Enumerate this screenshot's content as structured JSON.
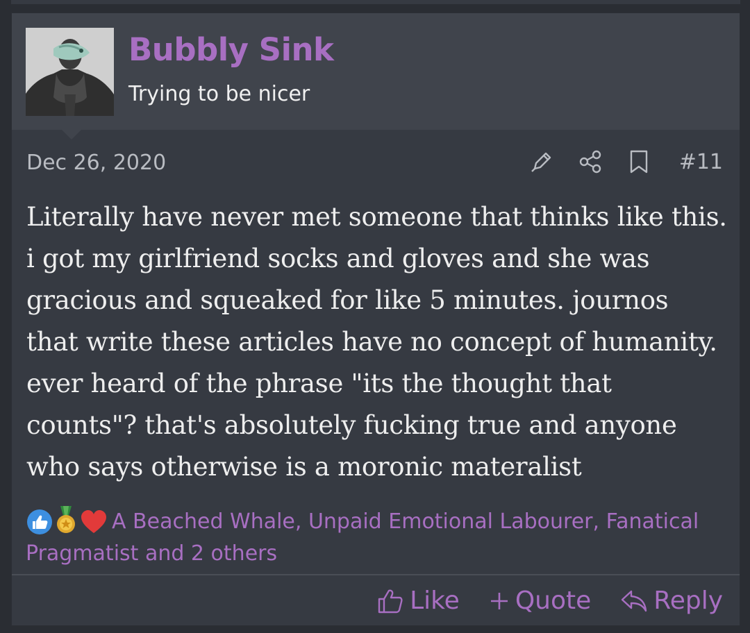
{
  "user": {
    "name": "Bubbly Sink",
    "title": "Trying to be nicer"
  },
  "post": {
    "date": "Dec 26, 2020",
    "number": "#11",
    "body": "Literally have never met someone that thinks like this. i got my girlfriend socks and gloves and she was gracious and squeaked for like 5 minutes. journos that write these articles have no concept of humanity. ever heard of the phrase \"its the thought that counts\"? that's absolutely fucking true and anyone who says otherwise is a moronic materalist"
  },
  "reactions": {
    "icons": [
      "like-icon",
      "medal-icon",
      "heart-icon"
    ],
    "text": "A Beached Whale, Unpaid Emotional Labourer, Fanatical Pragmatist and 2 others"
  },
  "tools": {
    "icons": [
      "edit-pen-icon",
      "share-icon",
      "bookmark-icon"
    ]
  },
  "actions": {
    "like_label": "Like",
    "quote_label": "Quote",
    "reply_label": "Reply"
  },
  "colors": {
    "accent": "#a86fc2",
    "panel": "#363a42",
    "header": "#40444c",
    "text": "#eeeeee"
  }
}
